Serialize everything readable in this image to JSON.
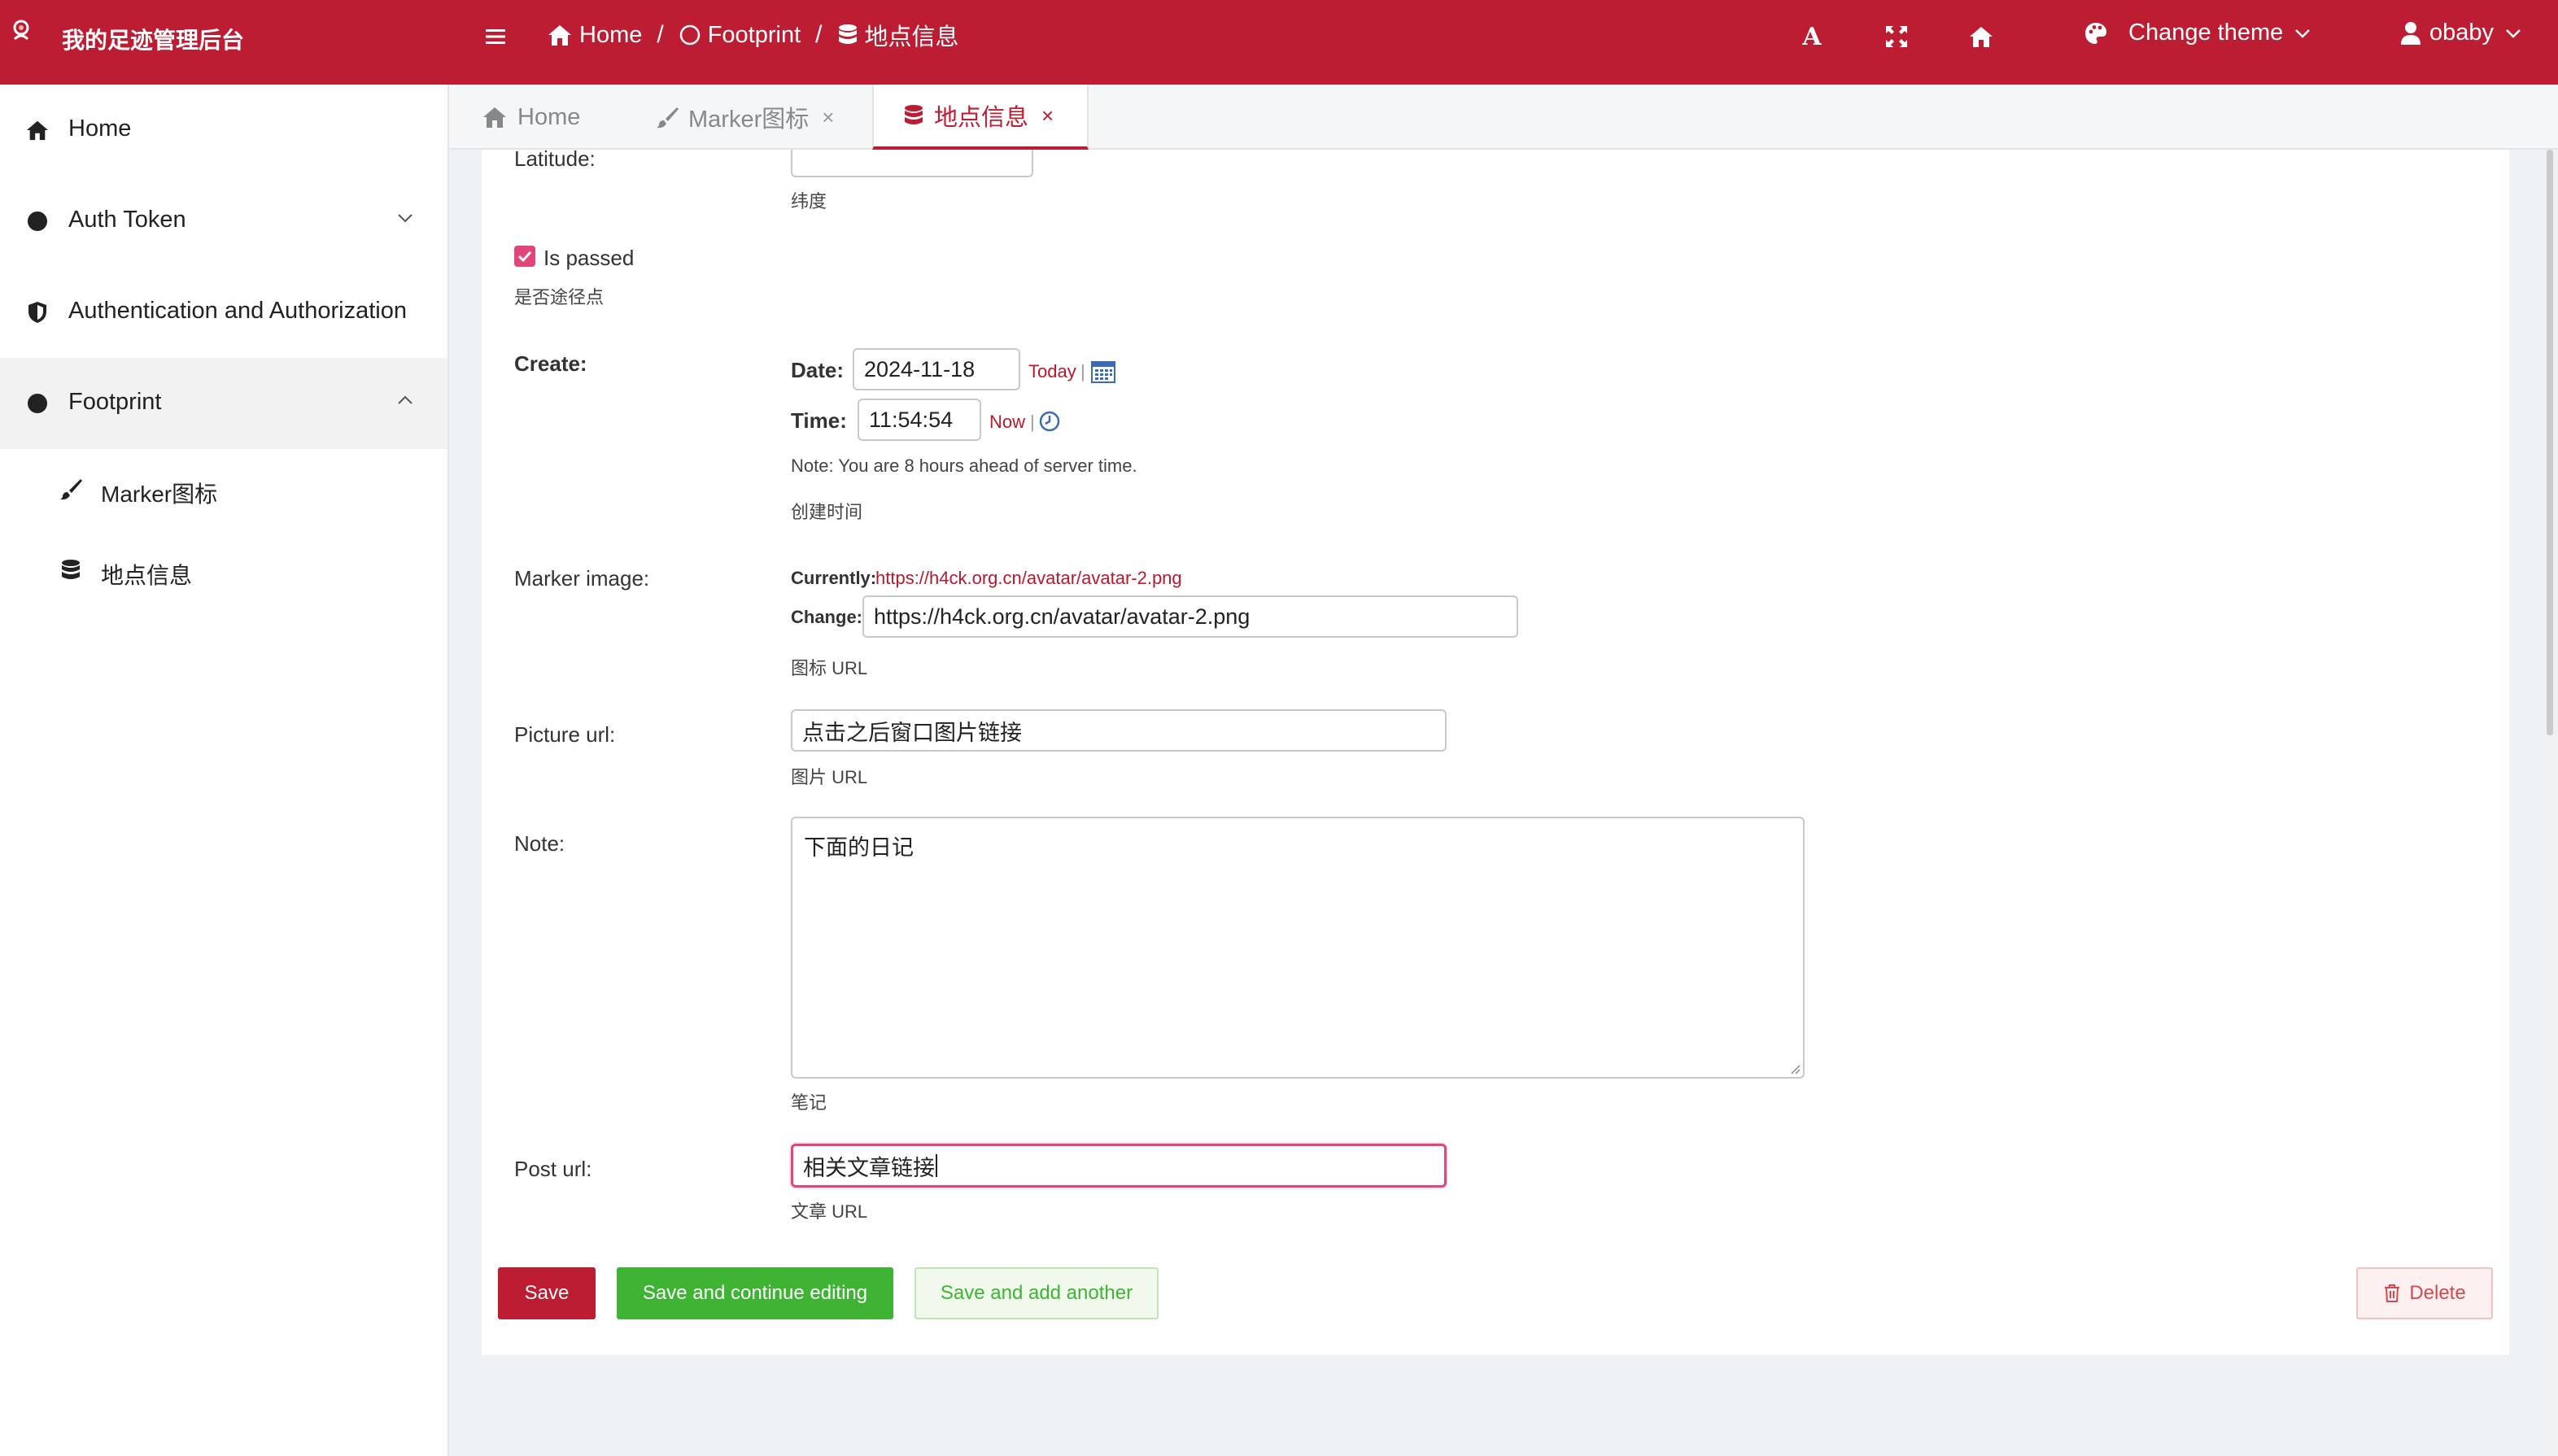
{
  "brand": {
    "title": "我的足迹管理后台"
  },
  "breadcrumb": {
    "home": "Home",
    "section": "Footprint",
    "current": "地点信息",
    "sep": "/"
  },
  "header": {
    "theme_label": "Change theme",
    "user": "obaby",
    "font_icon_glyph": "A"
  },
  "sidebar": {
    "items": [
      {
        "label": "Home"
      },
      {
        "label": "Auth Token"
      },
      {
        "label": "Authentication and Authorization"
      },
      {
        "label": "Footprint"
      }
    ],
    "subitems": [
      {
        "label": "Marker图标"
      },
      {
        "label": "地点信息"
      }
    ]
  },
  "tabs": [
    {
      "label": "Home"
    },
    {
      "label": "Marker图标",
      "close": "×"
    },
    {
      "label": "地点信息",
      "close": "×"
    }
  ],
  "form": {
    "latitude": {
      "label": "Latitude:",
      "help": "纬度"
    },
    "is_passed": {
      "label": "Is passed",
      "help": "是否途径点",
      "checked": true
    },
    "create": {
      "label": "Create:",
      "date_label": "Date:",
      "date_value": "2024-11-18",
      "today": "Today",
      "pipe": "|",
      "time_label": "Time:",
      "time_value": "11:54:54",
      "now": "Now",
      "note": "Note: You are 8 hours ahead of server time.",
      "help": "创建时间"
    },
    "marker_image": {
      "label": "Marker image:",
      "currently_label": "Currently:",
      "currently_url": "https://h4ck.org.cn/avatar/avatar-2.png",
      "change_label": "Change:",
      "change_value": "https://h4ck.org.cn/avatar/avatar-2.png",
      "help": "图标 URL"
    },
    "picture_url": {
      "label": "Picture url:",
      "value": "点击之后窗口图片链接",
      "help": "图片 URL"
    },
    "note": {
      "label": "Note:",
      "value": "下面的日记",
      "help": "笔记"
    },
    "post_url": {
      "label": "Post url:",
      "value": "相关文章链接",
      "help": "文章 URL"
    }
  },
  "buttons": {
    "save": "Save",
    "save_continue": "Save and continue editing",
    "save_add": "Save and add another",
    "delete": "Delete"
  },
  "colors": {
    "primary": "#bd1d32",
    "success": "#3fb334",
    "danger": "#d9474f",
    "focus": "#e2457a"
  }
}
